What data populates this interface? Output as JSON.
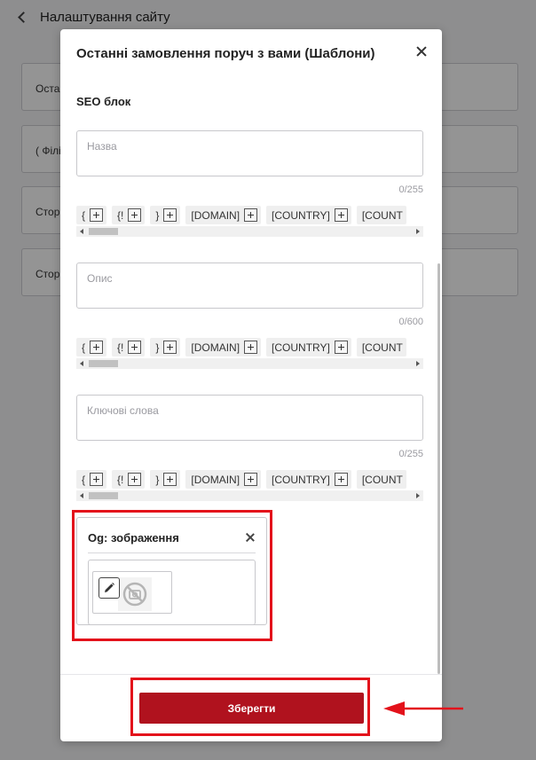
{
  "background": {
    "back_label": "Налаштування сайту",
    "cards": [
      "Оста",
      "( Філі",
      "Стор",
      "Стор"
    ]
  },
  "modal": {
    "title": "Останні замовлення поруч з вами (Шаблони)",
    "seo_title": "SEO блок",
    "fields": [
      {
        "placeholder": "Назва",
        "counter": "0/255",
        "tags": [
          "{",
          "{!",
          "}",
          "[DOMAIN]",
          "[COUNTRY]",
          "[COUNT"
        ]
      },
      {
        "placeholder": "Опис",
        "counter": "0/600",
        "tags": [
          "{",
          "{!",
          "}",
          "[DOMAIN]",
          "[COUNTRY]",
          "[COUNT"
        ]
      },
      {
        "placeholder": "Ключові слова",
        "counter": "0/255",
        "tags": [
          "{",
          "{!",
          "}",
          "[DOMAIN]",
          "[COUNTRY]",
          "[COUNT"
        ]
      }
    ],
    "og_image": {
      "title": "Og: зображення",
      "edit_icon": "pencil-icon",
      "placeholder_icon": "no-image-icon"
    },
    "save_label": "Зберегти"
  },
  "colors": {
    "accent": "#b0121e",
    "highlight": "#e3121b",
    "overlay": "rgba(0,0,0,0.42)"
  }
}
